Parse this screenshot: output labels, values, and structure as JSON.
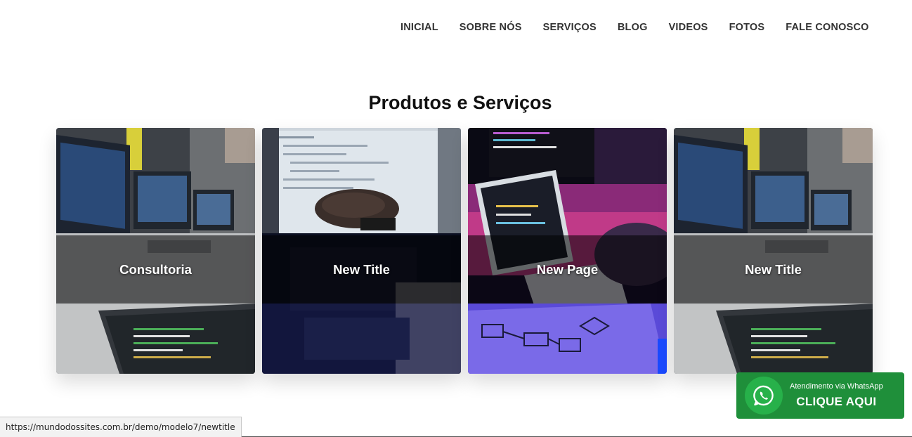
{
  "nav": {
    "items": [
      {
        "label": "INICIAL"
      },
      {
        "label": "SOBRE NÓS"
      },
      {
        "label": "SERVIÇOS"
      },
      {
        "label": "BLOG"
      },
      {
        "label": "VIDEOS"
      },
      {
        "label": "FOTOS"
      },
      {
        "label": "FALE CONOSCO"
      }
    ]
  },
  "section": {
    "title": "Produtos e Serviços"
  },
  "cards": [
    {
      "title": "Consultoria",
      "image": "office-monitors-tablet-photo"
    },
    {
      "title": "New Title",
      "image": "hands-typing-laptop-photo"
    },
    {
      "title": "New Page",
      "image": "neon-desk-code-photo"
    },
    {
      "title": "New Title",
      "image": "office-monitors-tablet-photo"
    }
  ],
  "status_bar": {
    "url": "https://mundodossites.com.br/demo/modelo7/newtitle"
  },
  "whatsapp": {
    "caption": "Atendimento via WhatsApp",
    "cta": "CLIQUE AQUI",
    "icon": "whatsapp-icon"
  }
}
